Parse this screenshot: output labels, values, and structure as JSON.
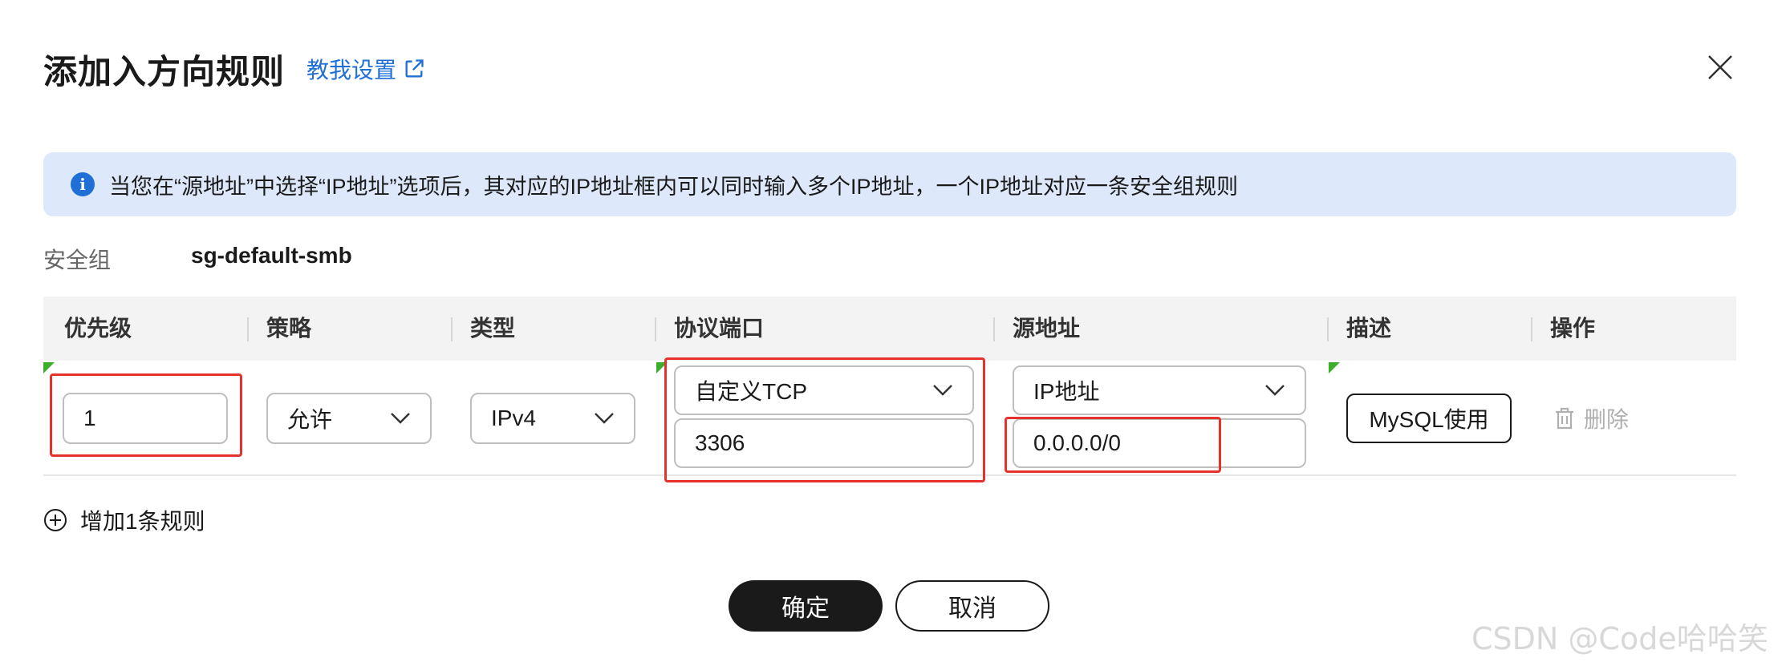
{
  "dialog": {
    "title": "添加入方向规则",
    "help_link": "教我设置"
  },
  "notice": {
    "icon": "info-icon",
    "text": "当您在“源地址”中选择“IP地址”选项后，其对应的IP地址框内可以同时输入多个IP地址，一个IP地址对应一条安全组规则"
  },
  "security_group": {
    "label": "安全组",
    "value": "sg-default-smb"
  },
  "table": {
    "headers": [
      "优先级",
      "策略",
      "类型",
      "协议端口",
      "源地址",
      "描述",
      "操作"
    ],
    "row": {
      "priority": "1",
      "policy": "允许",
      "type": "IPv4",
      "protocol": "自定义TCP",
      "port": "3306",
      "source_type": "IP地址",
      "source_value": "0.0.0.0/0",
      "description": "MySQL使用",
      "delete": "删除"
    }
  },
  "add_rule": "增加1条规则",
  "footer": {
    "confirm": "确定",
    "cancel": "取消"
  },
  "watermark": "CSDN @Code哈哈笑",
  "colors": {
    "accent": "#1f6fd6",
    "highlight": "#e5322d",
    "notice_bg": "#dde9fb",
    "primary_button": "#1a1a1a"
  }
}
